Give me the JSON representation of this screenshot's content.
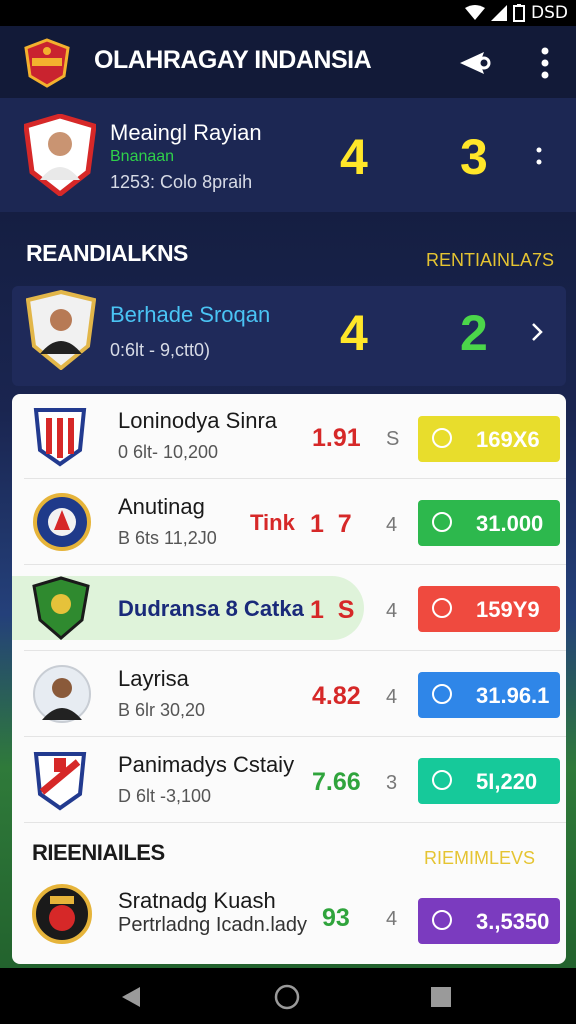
{
  "status_bar": {
    "time": "DSD",
    "icons": [
      "wifi-icon",
      "signal-icon",
      "battery-icon"
    ]
  },
  "app_bar": {
    "title": "OLAHRAGAY INDANSIA",
    "actions": [
      "share-icon",
      "more-vert-icon"
    ]
  },
  "live_match": {
    "team": "Meaingl Rayian",
    "subtitle": "Bnanaan",
    "meta": "1253: Colo 8praih",
    "score_home": "4",
    "score_away": "3"
  },
  "section1": {
    "title": "REANDIALKNS",
    "link": "RENTIAINLA7S"
  },
  "featured": {
    "team": "Berhade Sroqan",
    "meta": "0:6lt - 9,ctt0)",
    "score_home": "4",
    "score_away": "2"
  },
  "rows": [
    {
      "team": "Loninodya Sinra",
      "meta": "0 6lt- 10,200",
      "odds": "1.91",
      "odds_color": "#d62828",
      "extra": "",
      "count": "S",
      "pill_value": "169X6",
      "pill_color": "#e8dd2c"
    },
    {
      "team": "Anutinag",
      "meta": "B 6ts 11,2J0",
      "odds": "1  7",
      "odds_color": "#d62828",
      "extra": "Tink",
      "count": "4",
      "pill_value": "31.000",
      "pill_color": "#2db84d"
    },
    {
      "team": "Dudransa 8 Catka",
      "meta": "",
      "odds": "1  S",
      "odds_color": "#d62828",
      "extra": "",
      "count": "4",
      "pill_value": "159Y9",
      "pill_color": "#ef4a3f"
    },
    {
      "team": "Layrisa",
      "meta": "B 6lr 30,20",
      "odds": "4.82",
      "odds_color": "#d62828",
      "extra": "",
      "count": "4",
      "pill_value": "31.96.1",
      "pill_color": "#2f86e8"
    },
    {
      "team": "Panimadys Cstaiy",
      "meta": "D 6lt -3,100",
      "odds": "7.66",
      "odds_color": "#2fa43c",
      "extra": "",
      "count": "3",
      "pill_value": "5I,220",
      "pill_color": "#16c99a"
    }
  ],
  "section2": {
    "title": "RIEENIAILES",
    "link": "RIEMIMLEVS"
  },
  "last_row": {
    "team": "Sratnadg Kuash",
    "meta": "Pertrladng Icadn.lady",
    "odds": "93",
    "count": "4",
    "pill_value": "3.,5350",
    "pill_color": "#7b3bbf"
  },
  "nav": [
    "back-icon",
    "home-icon",
    "recents-icon"
  ]
}
